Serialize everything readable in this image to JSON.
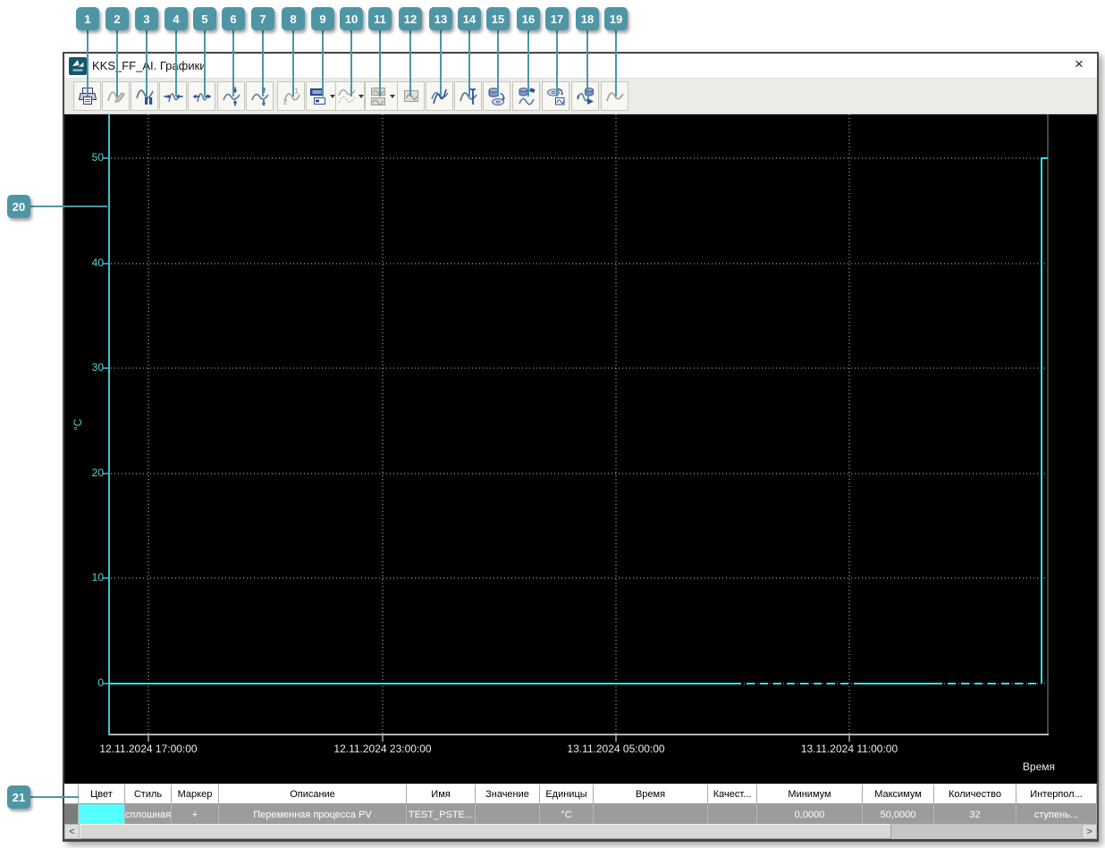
{
  "callouts": {
    "color": "#4E96A6",
    "labels": [
      "1",
      "2",
      "3",
      "4",
      "5",
      "6",
      "7",
      "8",
      "9",
      "10",
      "11",
      "12",
      "13",
      "14",
      "15",
      "16",
      "17",
      "18",
      "19",
      "20",
      "21"
    ]
  },
  "window": {
    "title": "KKS_FF_AI. Графики",
    "close_label": "×"
  },
  "toolbar": {
    "buttons": [
      {
        "num": 1,
        "icon": "print-icon",
        "disabled": false,
        "dropdown": false
      },
      {
        "num": 2,
        "icon": "edit-trend-icon",
        "disabled": true,
        "dropdown": false
      },
      {
        "num": 3,
        "icon": "pause-trend-icon",
        "disabled": false,
        "dropdown": false
      },
      {
        "num": 4,
        "icon": "compress-time-axis-icon",
        "disabled": false,
        "dropdown": false
      },
      {
        "num": 5,
        "icon": "expand-time-axis-icon",
        "disabled": false,
        "dropdown": false
      },
      {
        "num": 6,
        "icon": "compress-value-axis-icon",
        "disabled": false,
        "dropdown": false
      },
      {
        "num": 7,
        "icon": "expand-value-axis-icon",
        "disabled": false,
        "dropdown": false
      },
      {
        "num": 8,
        "icon": "half-scale-icon",
        "disabled": true,
        "dropdown": false
      },
      {
        "num": 9,
        "icon": "display-layout-icon",
        "disabled": false,
        "dropdown": true
      },
      {
        "num": 10,
        "icon": "overlay-trends-icon",
        "disabled": true,
        "dropdown": true
      },
      {
        "num": 11,
        "icon": "trend-windows-icon",
        "disabled": true,
        "dropdown": true
      },
      {
        "num": 12,
        "icon": "single-trend-window-icon",
        "disabled": true,
        "dropdown": false
      },
      {
        "num": 13,
        "icon": "compare-trends-icon",
        "disabled": false,
        "dropdown": false
      },
      {
        "num": 14,
        "icon": "trend-cursor-icon",
        "disabled": false,
        "dropdown": false
      },
      {
        "num": 15,
        "icon": "export-data-icon",
        "disabled": false,
        "dropdown": false
      },
      {
        "num": 16,
        "icon": "load-archive-data-icon",
        "disabled": false,
        "dropdown": false
      },
      {
        "num": 17,
        "icon": "archive-to-window-icon",
        "disabled": false,
        "dropdown": false
      },
      {
        "num": 18,
        "icon": "play-archive-icon",
        "disabled": false,
        "dropdown": false
      },
      {
        "num": 19,
        "icon": "trend-curve-icon",
        "disabled": true,
        "dropdown": false
      }
    ]
  },
  "chart_data": {
    "type": "line",
    "title": "",
    "xlabel": "Время",
    "ylabel": "°C",
    "background": "#000000",
    "grid": true,
    "y_ticks": [
      0,
      10,
      20,
      30,
      40,
      50
    ],
    "ylim": [
      -6.5,
      54.2
    ],
    "x_ticks": [
      "12.11.2024 17:00:00",
      "12.11.2024 23:00:00",
      "13.11.2024 05:00:00",
      "13.11.2024 11:00:00"
    ],
    "x_range_approx": [
      "12.11.2024 16:00:00",
      "13.11.2024 16:05:00"
    ],
    "series": [
      {
        "name": "TEST_PSTE...",
        "description": "Переменная процесса PV",
        "color": "#29E2E2",
        "points": [
          {
            "time": "12.11.2024 16:00:00",
            "value": 0
          },
          {
            "time": "13.11.2024 15:52:00",
            "value": 0
          },
          {
            "time": "13.11.2024 15:52:00",
            "value": 50
          },
          {
            "time": "13.11.2024 16:05:00",
            "value": 50
          }
        ],
        "zero_line_segments": [
          {
            "style": "solid",
            "from_frac": 0.0,
            "to_frac": 0.665
          },
          {
            "style": "dashed",
            "from_frac": 0.665,
            "to_frac": 0.794
          },
          {
            "style": "solid",
            "from_frac": 0.794,
            "to_frac": 0.879
          },
          {
            "style": "dashed",
            "from_frac": 0.879,
            "to_frac": 0.993
          }
        ],
        "step_up_at_frac": 0.993,
        "final_value": 50
      }
    ]
  },
  "table": {
    "headers": [
      "",
      "Цвет",
      "Стиль",
      "Маркер",
      "Описание",
      "Имя",
      "Значение",
      "Единицы",
      "Время",
      "Качест...",
      "Минимум",
      "Максимум",
      "Количество",
      "Интерпол..."
    ],
    "row": {
      "color": "#55FFFF",
      "style": "сплошная",
      "marker": "+",
      "description": "Переменная процесса PV",
      "name": "TEST_PSTE...",
      "value": "",
      "units": "°C",
      "time": "",
      "quality": "",
      "min": "0,0000",
      "max": "50,0000",
      "count": "32",
      "interpolation": "ступень..."
    }
  },
  "scrollbar": {
    "left_arrow": "<",
    "right_arrow": ">"
  }
}
